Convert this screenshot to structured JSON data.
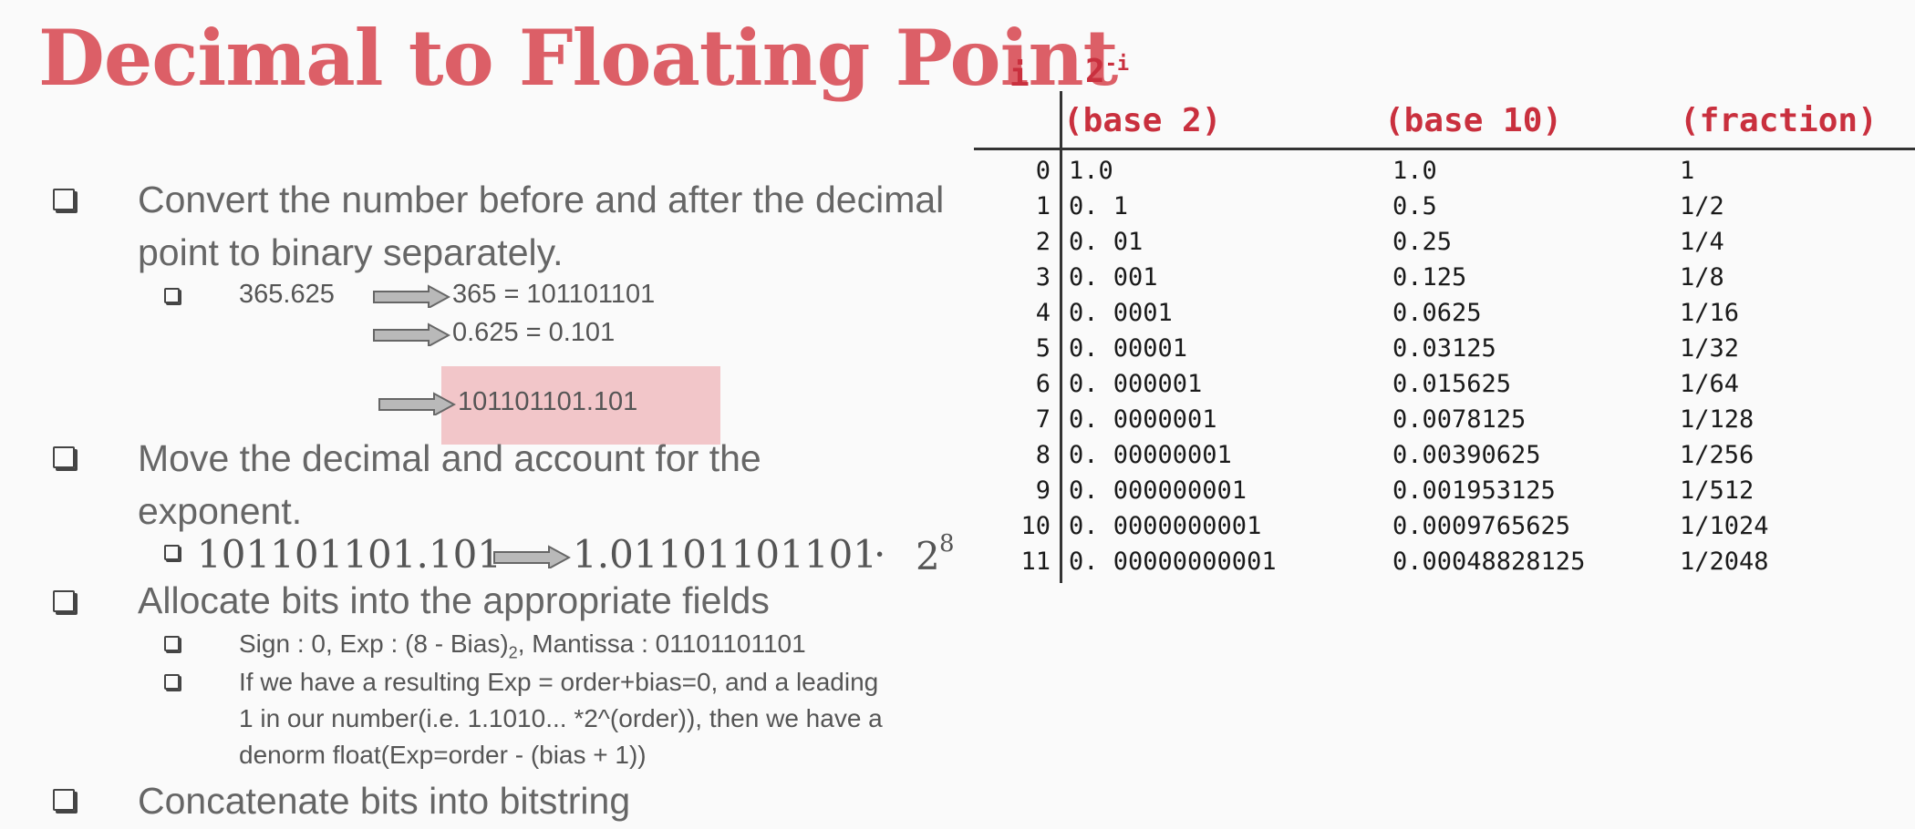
{
  "title": "Decimal to Floating Point",
  "bullets": [
    {
      "text": "Convert the number before and after the decimal point to binary separately."
    },
    {
      "text": "Move the decimal and account for the exponent."
    },
    {
      "text": "Allocate bits into the appropriate fields"
    },
    {
      "text": "Concatenate bits into bitstring"
    }
  ],
  "conversion": {
    "input": "365.625",
    "integer_part": "365 = 101101101",
    "fraction_part": "0.625 = 0.101",
    "result": "101101101.101"
  },
  "exponent_step": {
    "from": "101101101.101",
    "to": "1.01101101101",
    "dot": "·",
    "base": "2",
    "power": "8"
  },
  "fields": {
    "sign_exp_a": "Sign : 0, Exp : (8 - Bias)",
    "sign_exp_sub": "2",
    "sign_exp_b": ", Mantissa : 01101101101",
    "denorm_lines": [
      "If we have a resulting Exp = order+bias=0, and a leading",
      "1 in our number(i.e. 1.1010... *2^(order)), then we have a",
      "denorm float(Exp=order - (bias + 1))"
    ]
  },
  "table": {
    "header_i": "i",
    "header_two": "2",
    "header_two_exp": "-i",
    "columns": [
      "(base 2)",
      "(base 10)",
      "(fraction)"
    ],
    "rows": [
      {
        "i": "0",
        "b2": "1.0",
        "b10": "1.0",
        "frac": "1"
      },
      {
        "i": "1",
        "b2": "0. 1",
        "b10": "0.5",
        "frac": "1/2"
      },
      {
        "i": "2",
        "b2": "0. 01",
        "b10": "0.25",
        "frac": "1/4"
      },
      {
        "i": "3",
        "b2": "0. 001",
        "b10": "0.125",
        "frac": "1/8"
      },
      {
        "i": "4",
        "b2": "0. 0001",
        "b10": "0.0625",
        "frac": "1/16"
      },
      {
        "i": "5",
        "b2": "0. 00001",
        "b10": "0.03125",
        "frac": "1/32"
      },
      {
        "i": "6",
        "b2": "0. 000001",
        "b10": "0.015625",
        "frac": "1/64"
      },
      {
        "i": "7",
        "b2": "0. 0000001",
        "b10": "0.0078125",
        "frac": "1/128"
      },
      {
        "i": "8",
        "b2": "0. 00000001",
        "b10": "0.00390625",
        "frac": "1/256"
      },
      {
        "i": "9",
        "b2": "0. 000000001",
        "b10": "0.001953125",
        "frac": "1/512"
      },
      {
        "i": "10",
        "b2": "0. 0000000001",
        "b10": "0.0009765625",
        "frac": "1/1024"
      },
      {
        "i": "11",
        "b2": "0. 00000000001",
        "b10": "0.00048828125",
        "frac": "1/2048"
      }
    ]
  },
  "colors": {
    "title": "#dc5f67",
    "table_header": "#c9303e",
    "highlight": "#f2c6c9"
  }
}
